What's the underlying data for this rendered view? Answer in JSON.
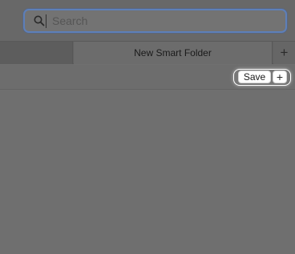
{
  "toolbar": {
    "search": {
      "placeholder": "Search",
      "value": "",
      "icon": "search-icon"
    }
  },
  "tabs": {
    "active_label": "New Smart Folder",
    "add_label": "+"
  },
  "search_criteria_bar": {
    "save_label": "Save",
    "add_label": "+"
  },
  "colors": {
    "window_background": "#6f6f6f",
    "focus_ring": "#5d7fb9",
    "button_background": "#ffffff"
  }
}
